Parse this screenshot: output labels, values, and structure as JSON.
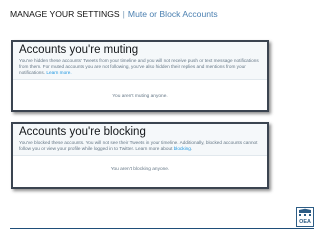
{
  "slide": {
    "title": "MANAGE YOUR SETTINGS",
    "separator": "|",
    "subtitle": "Mute  or Block Accounts"
  },
  "muting": {
    "heading": "Accounts you're muting",
    "description": "You've hidden these accounts' Tweets from your timeline and you will not receive push or text message notifications from them. For muted accounts you are not following, you've also hidden their replies and mentions from your notifications.",
    "link": "Learn more.",
    "empty_message": "You aren't muting anyone."
  },
  "blocking": {
    "heading": "Accounts you're blocking",
    "description": "You've blocked these accounts. You will not see their Tweets in your timeline. Additionally, blocked accounts cannot follow you or view your profile while logged in to Twitter. Learn more about",
    "link": "blocking",
    "link_suffix": ".",
    "empty_message": "You aren't blocking anyone."
  },
  "logo": {
    "text": "OEA",
    "icon": "organization-logo-icon",
    "color": "#2d5c85"
  },
  "colors": {
    "title_text": "#111111",
    "subtitle_text": "#4a7fb0",
    "twitter_link": "#1b95e0",
    "frame_border": "#3b4450",
    "footer_rule": "#1f4e79"
  }
}
